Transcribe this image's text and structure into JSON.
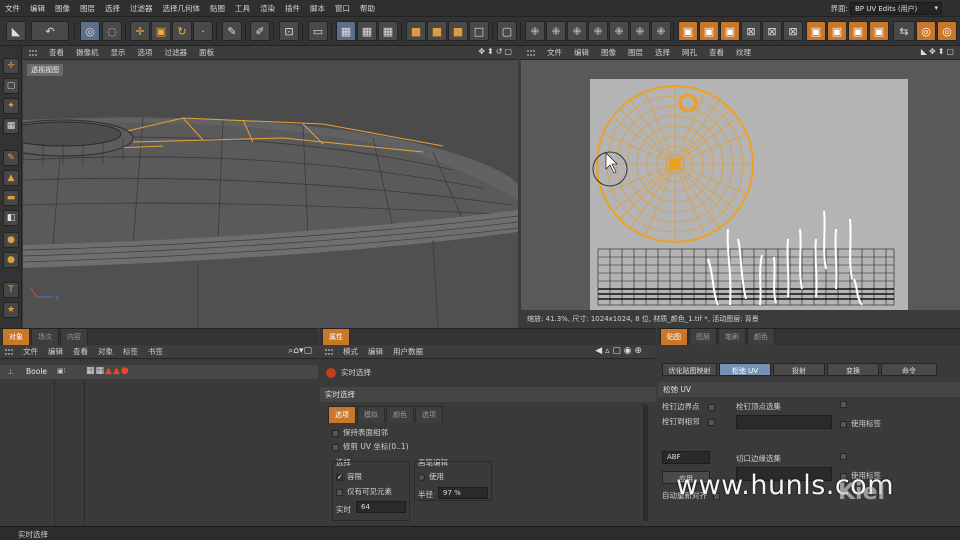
{
  "menubar": {
    "items": [
      "文件",
      "编辑",
      "图像",
      "图层",
      "选择",
      "过滤器",
      "选择几何体",
      "贴图",
      "工具",
      "渲染",
      "插件",
      "脚本",
      "窗口",
      "帮助"
    ],
    "layout_label": "界面:",
    "layout_value": "BP UV Edits (用户)"
  },
  "viewport3d": {
    "menu": [
      "查看",
      "摄像机",
      "显示",
      "选项",
      "过滤器",
      "面板"
    ],
    "label": "透视视图",
    "axis_z": "z"
  },
  "uv_view": {
    "menu": [
      "文件",
      "编辑",
      "图像",
      "图层",
      "选择",
      "网孔",
      "查看",
      "纹理"
    ],
    "status": "缩放: 41.3%, 尺寸: 1024x1024, 8 位, 材质_颜色_1.tif *, 活动图层: 背景"
  },
  "objects_panel": {
    "tabs": [
      "对象",
      "场次",
      "内容"
    ],
    "menu": [
      "文件",
      "编辑",
      "查看",
      "对象",
      "标签",
      "书签"
    ],
    "object_name": "Boole"
  },
  "attributes_panel": {
    "tab": "属性",
    "menu": [
      "模式",
      "编辑",
      "用户数据"
    ],
    "tool_name": "实时选择",
    "section_title": "实时选择",
    "subtabs": [
      "选项",
      "模拟",
      "颜色",
      "选项"
    ],
    "keep_surface": "保持表面相邻",
    "clip_uv": "修剪 UV 坐标(0..1)",
    "select_group": "选择",
    "cap_label": "容限",
    "visible_only": "仅有可见元素",
    "realtime_label": "实时",
    "realtime_value": "64",
    "brush_group": "画笔编辑",
    "use_label": "使用",
    "radius_label": "半径",
    "radius_value": "97 %"
  },
  "uv_panel": {
    "tabs": [
      "贴图",
      "图层",
      "笔刷",
      "颜色"
    ],
    "buttons": [
      "优化贴图映射",
      "松弛 UV",
      "投射",
      "变换",
      "命令"
    ],
    "active_button": "松弛 UV",
    "section": "松弛 UV",
    "pin_border": "栓钉边界点",
    "pin_neighbor": "栓钉到相邻",
    "pin_selected": "栓钉顶点选集",
    "use_tag": "使用标签",
    "method": "ABF",
    "apply": "应用",
    "auto_realign": "自动重新对齐",
    "cut_edges": "切口边缘选集",
    "use_tag2": "使用标签"
  },
  "statusbar": {
    "text": "实时选择"
  },
  "overlay": {
    "watermark": "www.hunls.com",
    "brand": "Kiel"
  }
}
